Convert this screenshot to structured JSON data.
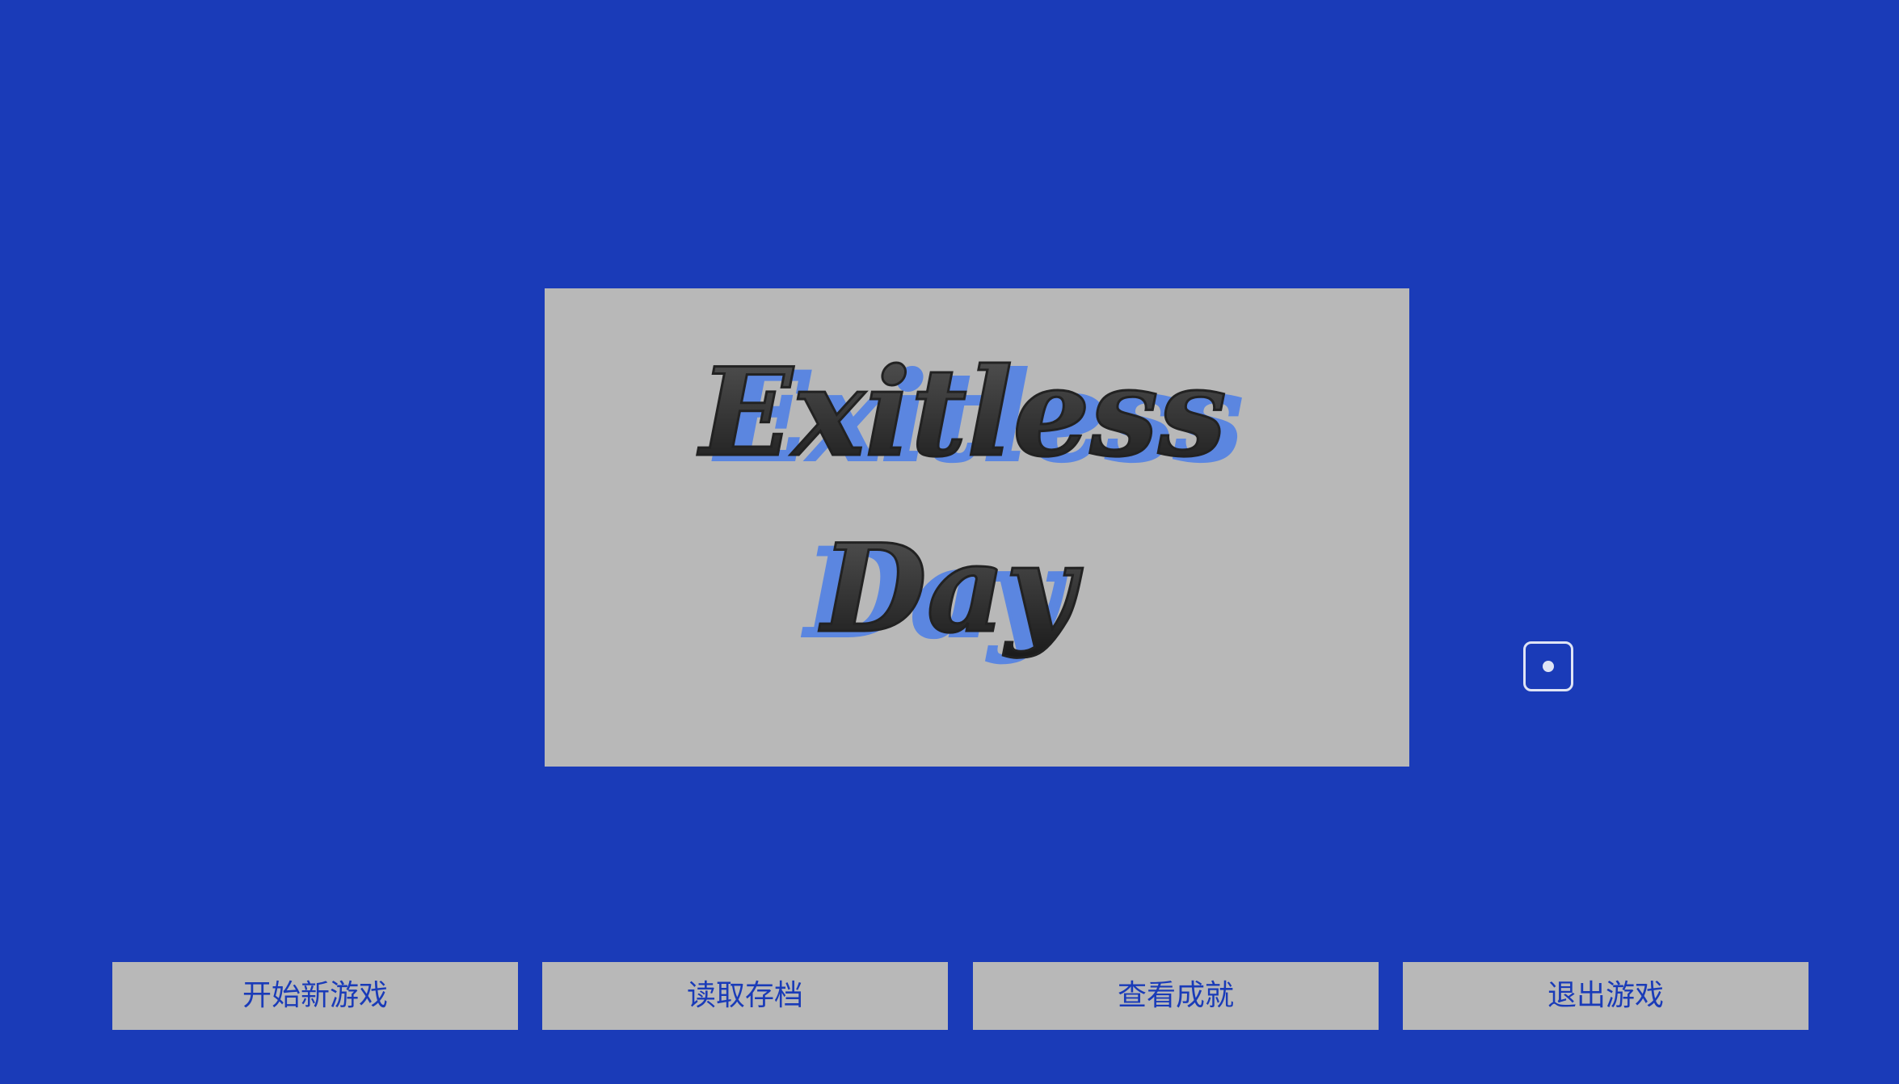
{
  "title": {
    "line1": "Exitless",
    "line2": "Day"
  },
  "dice": {
    "icon": "dice-one-icon"
  },
  "menu": {
    "items": [
      {
        "label": "开始新游戏"
      },
      {
        "label": "读取存档"
      },
      {
        "label": "查看成就"
      },
      {
        "label": "退出游戏"
      }
    ]
  },
  "colors": {
    "background": "#1a3bb8",
    "panel": "#b8b8b8",
    "title_ink": "#222222",
    "title_shadow": "#5b86e0",
    "button_text": "#1a3bb8"
  }
}
